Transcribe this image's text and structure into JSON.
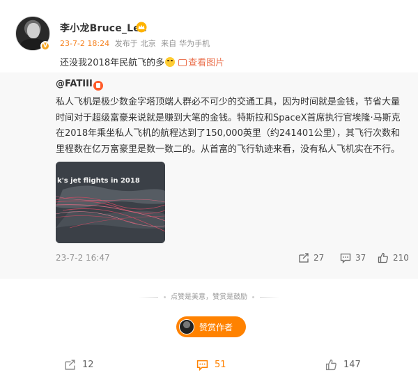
{
  "post": {
    "username": "李小龙Bruce_Lee",
    "time": "23-7-2 18:24",
    "posted_from_label": "发布于",
    "location": "北京",
    "source_label": "来自",
    "source": "华为手机",
    "text": "还没我2018年民航飞的多",
    "view_pic_label": "查看图片"
  },
  "repost": {
    "username": "@FATIII",
    "text": "私人飞机是极少数金字塔顶端人群必不可少的交通工具，因为时间就是金钱，节省大量时间对于超级富豪来说就是赚到大笔的金钱。特斯拉和SpaceX首席执行官埃隆·马斯克在2018年乘坐私人飞机的航程达到了150,000英里（约241401公里），其飞行次数和里程数在亿万富豪里是数一数二的。从首富的飞行轨迹来看，没有私人飞机实在不行。",
    "thumb_title": "k's jet flights in 2018",
    "time": "23-7-2 16:47",
    "reposts": "27",
    "comments": "37",
    "likes": "210"
  },
  "divider_text": "点赞是美意，赞赏是鼓励",
  "reward_label": "赞赏作者",
  "footer": {
    "reposts": "12",
    "comments": "51",
    "likes": "147"
  },
  "colors": {
    "accent": "#ff8200",
    "time_orange": "#f58220",
    "link": "#eb7350",
    "repost_bg": "#f8f8f8"
  },
  "icons": [
    "crown-icon",
    "verified-badge-icon",
    "emoji-icon",
    "picture-icon",
    "vip-badge-icon",
    "repost-icon",
    "comment-icon",
    "like-icon"
  ]
}
